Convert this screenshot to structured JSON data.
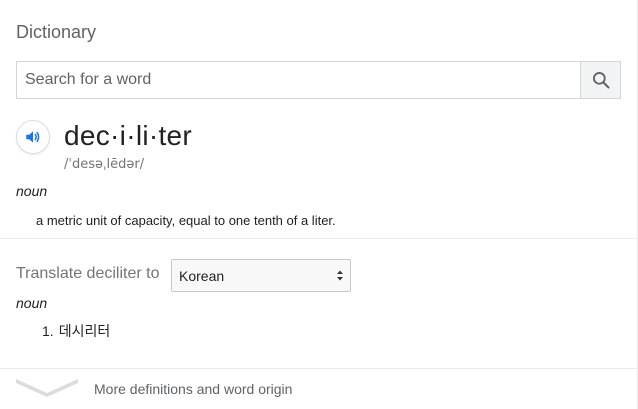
{
  "dictionary": {
    "title": "Dictionary",
    "search": {
      "placeholder": "Search for a word",
      "value": ""
    },
    "entry": {
      "word": "dec·i·li·ter",
      "phonetic": "/ˈdesəˌlēdər/",
      "part_of_speech": "noun",
      "definition": "a metric unit of capacity, equal to one tenth of a liter."
    },
    "translate": {
      "label": "Translate deciliter to",
      "selected_language": "Korean",
      "part_of_speech": "noun",
      "items": [
        {
          "number": "1.",
          "text": "데시리터"
        }
      ]
    },
    "more_link": "More definitions and word origin"
  },
  "icons": {
    "search": "search-icon",
    "speaker": "speaker-icon",
    "select_arrows": "select-arrows-icon",
    "chevron": "chevron-down-icon"
  },
  "colors": {
    "speaker_blue": "#1a73e8",
    "muted_text": "#70757a",
    "search_button_bg": "#f1f3f4"
  }
}
